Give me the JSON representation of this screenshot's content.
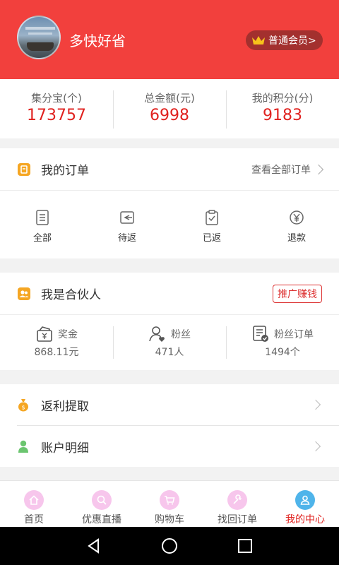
{
  "profile": {
    "username": "多快好省",
    "member_label": "普通会员>"
  },
  "stats": [
    {
      "label": "集分宝(个)",
      "value": "173757"
    },
    {
      "label": "总金额(元)",
      "value": "6998"
    },
    {
      "label": "我的积分(分)",
      "value": "9183"
    }
  ],
  "orders": {
    "title": "我的订单",
    "view_all": "查看全部订单",
    "items": [
      {
        "label": "全部",
        "icon": "list-icon"
      },
      {
        "label": "待返",
        "icon": "return-pending-icon"
      },
      {
        "label": "已返",
        "icon": "returned-check-icon"
      },
      {
        "label": "退款",
        "icon": "refund-yen-icon"
      }
    ]
  },
  "partner": {
    "title": "我是合伙人",
    "promote": "推广赚钱",
    "items": [
      {
        "name": "奖金",
        "value": "868.11元",
        "icon": "bonus-wallet-icon"
      },
      {
        "name": "粉丝",
        "value": "471人",
        "icon": "fans-person-icon"
      },
      {
        "name": "粉丝订单",
        "value": "1494个",
        "icon": "fan-orders-icon"
      }
    ]
  },
  "menu": [
    {
      "label": "返利提取",
      "icon": "money-bag-icon"
    },
    {
      "label": "账户明细",
      "icon": "account-person-icon"
    }
  ],
  "tabs": [
    {
      "label": "首页",
      "icon": "home-icon"
    },
    {
      "label": "优惠直播",
      "icon": "search-icon"
    },
    {
      "label": "购物车",
      "icon": "cart-icon"
    },
    {
      "label": "找回订单",
      "icon": "wrench-icon"
    },
    {
      "label": "我的中心",
      "icon": "user-center-icon",
      "active": true
    }
  ],
  "colors": {
    "brand_red": "#f2403d",
    "accent_value": "#e0221f",
    "tab_inactive_icon_bg": "#f7c6ec",
    "tab_active_icon_bg": "#4fb4ea"
  }
}
